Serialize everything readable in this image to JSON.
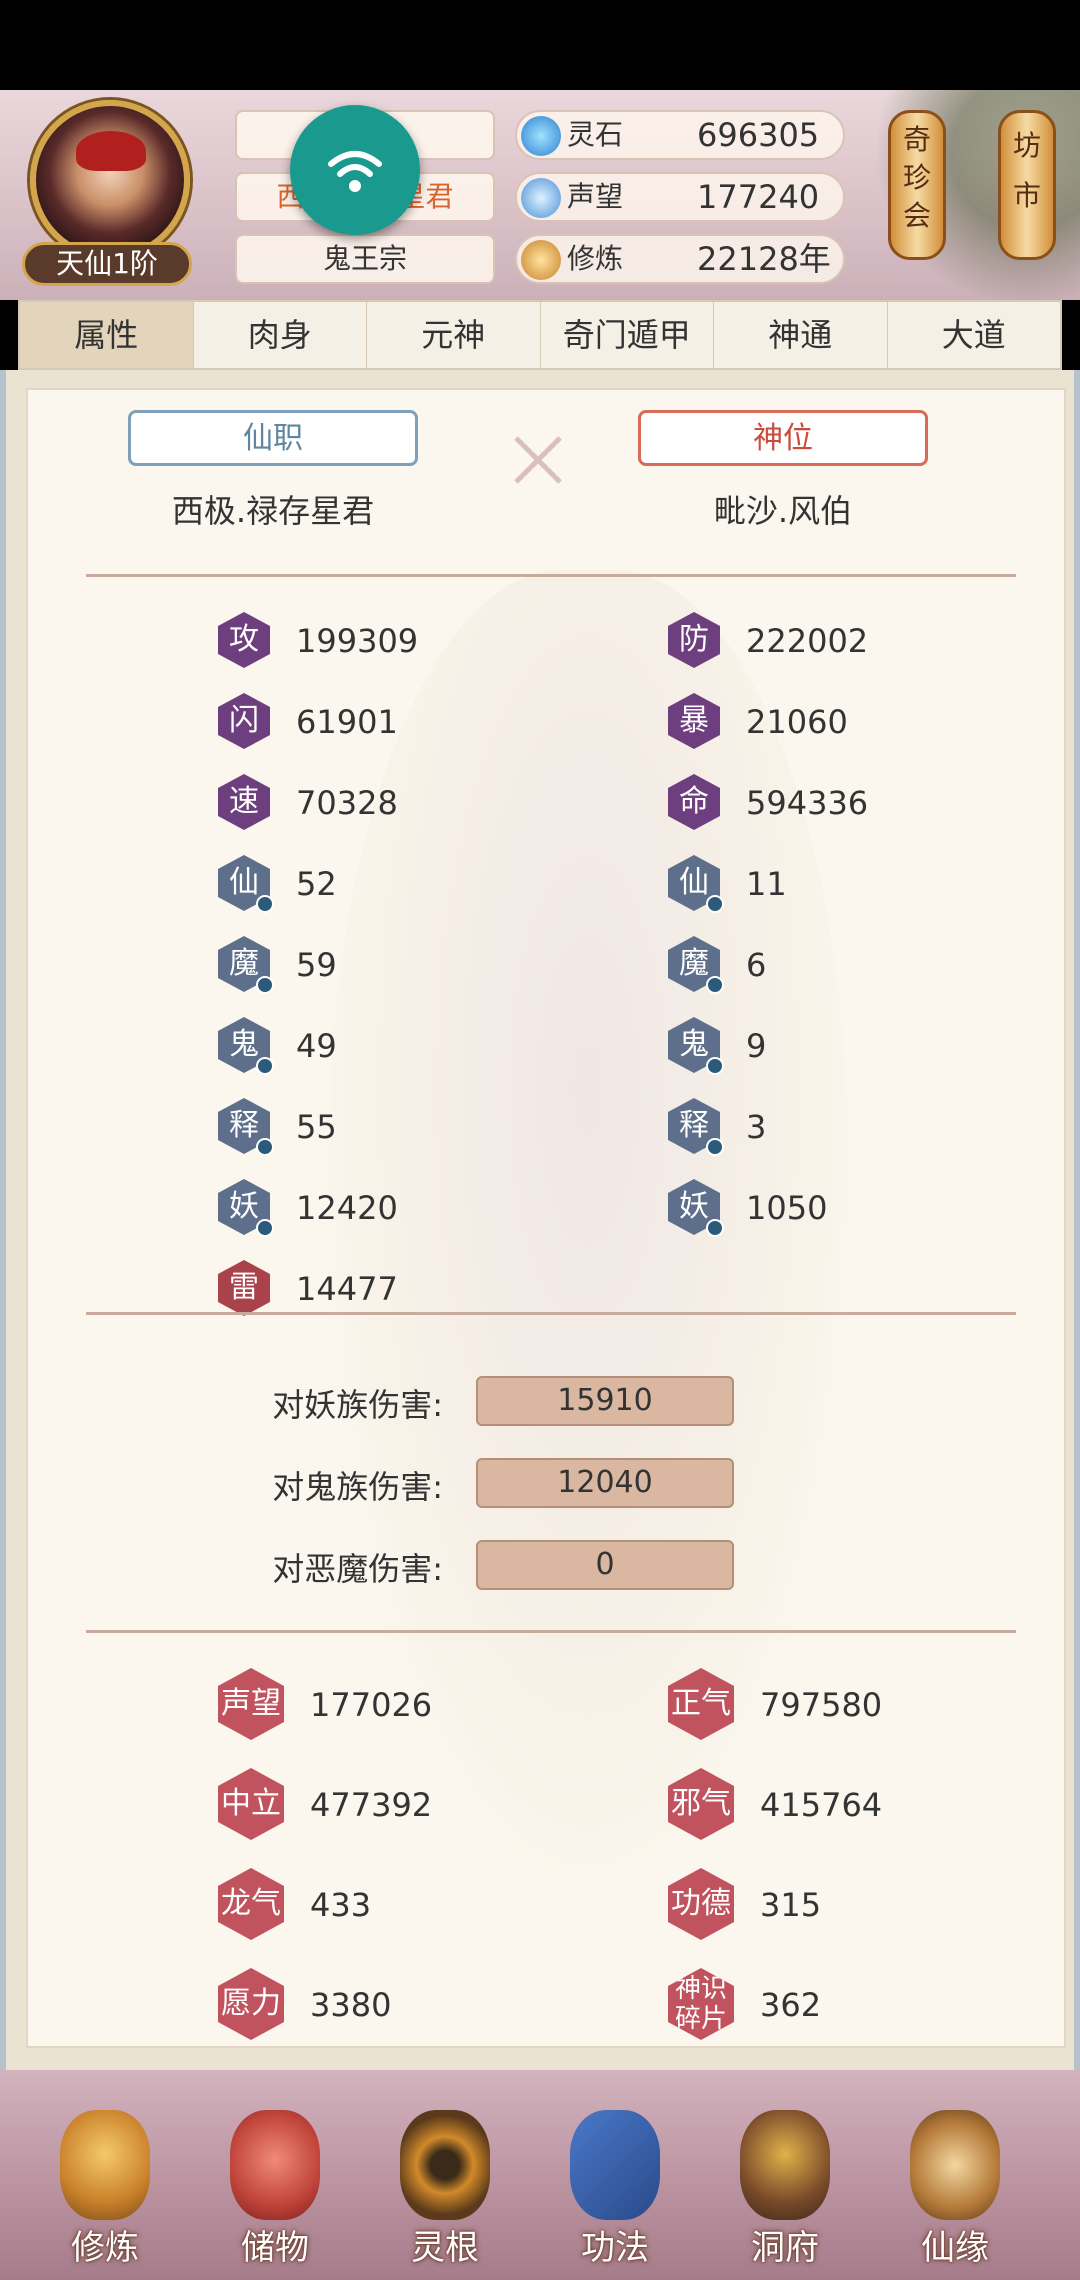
{
  "header": {
    "rank": "天仙1阶",
    "name_box": "",
    "title_box": "西极.禄存星君",
    "sect": "鬼王宗",
    "resources": [
      {
        "label": "灵石",
        "value": "696305",
        "icon": "spirit-stone-icon"
      },
      {
        "label": "声望",
        "value": "177240",
        "icon": "reputation-icon"
      },
      {
        "label": "修炼",
        "value": "22128年",
        "icon": "cultivation-icon"
      }
    ],
    "lanterns": [
      {
        "label": "奇珍会"
      },
      {
        "label": "坊市"
      }
    ]
  },
  "tabs": [
    "属性",
    "肉身",
    "元神",
    "奇门遁甲",
    "神通",
    "大道"
  ],
  "active_tab": "属性",
  "positions": {
    "xianzhi_label": "仙职",
    "xianzhi_value": "西极.禄存星君",
    "shenwei_label": "神位",
    "shenwei_value": "毗沙.风伯"
  },
  "stats_left": [
    {
      "glyph": "攻",
      "value": "199309"
    },
    {
      "glyph": "闪",
      "value": "61901"
    },
    {
      "glyph": "速",
      "value": "70328"
    },
    {
      "glyph": "仙",
      "value": "52"
    },
    {
      "glyph": "魔",
      "value": "59"
    },
    {
      "glyph": "鬼",
      "value": "49"
    },
    {
      "glyph": "释",
      "value": "55"
    },
    {
      "glyph": "妖",
      "value": "12420"
    },
    {
      "glyph": "雷",
      "value": "14477"
    }
  ],
  "stats_right": [
    {
      "glyph": "防",
      "value": "222002"
    },
    {
      "glyph": "暴",
      "value": "21060"
    },
    {
      "glyph": "命",
      "value": "594336"
    },
    {
      "glyph": "仙",
      "value": "11"
    },
    {
      "glyph": "魔",
      "value": "6"
    },
    {
      "glyph": "鬼",
      "value": "9"
    },
    {
      "glyph": "释",
      "value": "3"
    },
    {
      "glyph": "妖",
      "value": "1050"
    }
  ],
  "damage": [
    {
      "label": "对妖族伤害:",
      "value": "15910"
    },
    {
      "label": "对鬼族伤害:",
      "value": "12040"
    },
    {
      "label": "对恶魔伤害:",
      "value": "0"
    }
  ],
  "reputation_left": [
    {
      "label": "声望",
      "value": "177026"
    },
    {
      "label": "中立",
      "value": "477392"
    },
    {
      "label": "龙气",
      "value": "433"
    },
    {
      "label": "愿力",
      "value": "3380"
    }
  ],
  "reputation_right": [
    {
      "label": "正气",
      "value": "797580"
    },
    {
      "label": "邪气",
      "value": "415764"
    },
    {
      "label": "功德",
      "value": "315"
    },
    {
      "label": "神识碎片",
      "value": "362"
    }
  ],
  "bottom_nav": [
    "修炼",
    "储物",
    "灵根",
    "功法",
    "洞府",
    "仙缘"
  ]
}
